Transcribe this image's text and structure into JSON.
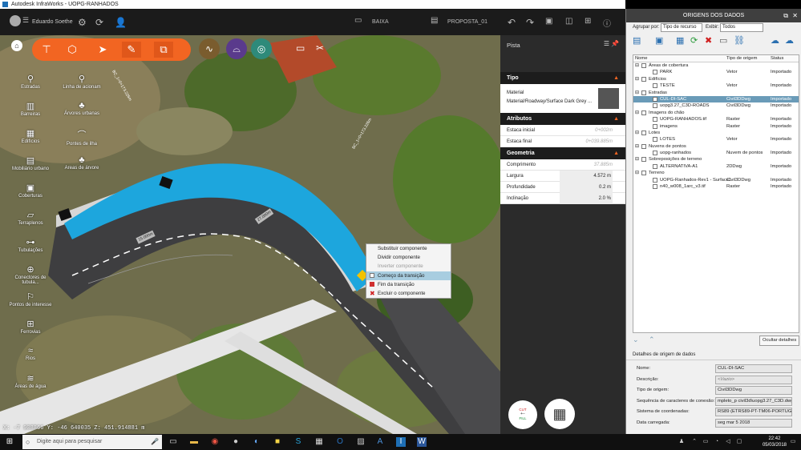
{
  "window": {
    "title": "Autodesk InfraWorks - UOPG-RANHADOS"
  },
  "toolbar": {
    "user": "Eduardo Soethe",
    "scenario": "BAIXA",
    "proposal": "PROPOSTA_01"
  },
  "left_tools": [
    {
      "label": "Estradas",
      "icon": "road-icon"
    },
    {
      "label": "Linha de acionam",
      "icon": "rail-icon"
    },
    {
      "label": "Barreiras",
      "icon": "barrier-icon"
    },
    {
      "label": "Árvores urbanas",
      "icon": "tree-icon"
    },
    {
      "label": "Edifícios",
      "icon": "building-icon"
    },
    {
      "label": "Pontes de ilha",
      "icon": "bridge-icon"
    },
    {
      "label": "Mobiliário urbano",
      "icon": "furniture-icon"
    },
    {
      "label": "Areas de árvore",
      "icon": "tree-area-icon"
    },
    {
      "label": "Coberturas",
      "icon": "coverage-icon"
    },
    {
      "label": "Terraplenos",
      "icon": "terrain-icon"
    },
    {
      "label": "Tubulações",
      "icon": "pipe-icon"
    },
    {
      "label": "Conectores de tubula...",
      "icon": "pipe-connector-icon"
    },
    {
      "label": "Pontos de interesse",
      "icon": "poi-icon"
    },
    {
      "label": "Ferrovias",
      "icon": "railway-icon"
    },
    {
      "label": "Rios",
      "icon": "river-icon"
    },
    {
      "label": "Áreas de água",
      "icon": "water-icon"
    }
  ],
  "map_labels": {
    "road_left": "15.000m",
    "road_mid": "27.000m",
    "road_right": "BC_1=0+173.226m",
    "road_top": "BC_1=0+173.226m"
  },
  "coordinates": "X: -7 908866 Y: -46 640035 Z: 451.914881 m",
  "context_menu": {
    "items": [
      {
        "label": "Substituir componente",
        "state": "normal"
      },
      {
        "label": "Dividir componente",
        "state": "normal"
      },
      {
        "label": "Inverter componente",
        "state": "disabled"
      },
      {
        "label": "Começo da transição",
        "state": "checkbox"
      },
      {
        "label": "Fim da transição",
        "state": "checked"
      },
      {
        "label": "Excluir o componente",
        "state": "delete"
      }
    ]
  },
  "properties": {
    "title": "Pista",
    "sections": {
      "tipo": "Tipo",
      "atributos": "Atributos",
      "geometria": "Geometria"
    },
    "material_label": "Material",
    "material_value": "Material/Roadway/Surface Dark Grey ...",
    "estaca_inicial": {
      "label": "Estaca inicial",
      "value": "0+002m"
    },
    "estaca_final": {
      "label": "Estaca final",
      "value": "0+039.885m"
    },
    "comprimento": {
      "label": "Comprimento",
      "value": "37.885m"
    },
    "largura": {
      "label": "Largura",
      "value": "4.572 m"
    },
    "profundidade": {
      "label": "Profundidade",
      "value": "0.2 m"
    },
    "inclinacao": {
      "label": "Inclinação",
      "value": "2.0 %"
    },
    "cutfill": {
      "cut": "CUT",
      "fill": "FILL"
    }
  },
  "data_sources": {
    "title": "ORIGENS DOS DADOS",
    "group_by_label": "Agrupar por:",
    "group_by_value": "Tipo de recurso",
    "show_label": "Exibir:",
    "show_value": "Todos",
    "columns": [
      "Nome",
      "Tipo de origem",
      "Status"
    ],
    "rows": [
      {
        "level": 0,
        "name": "Áreas de cobertura",
        "type": "",
        "status": ""
      },
      {
        "level": 1,
        "name": "PARK",
        "type": "Vetor",
        "status": "Importado"
      },
      {
        "level": 0,
        "name": "Edifícios",
        "type": "",
        "status": ""
      },
      {
        "level": 1,
        "name": "TESTE",
        "type": "Vetor",
        "status": "Importado"
      },
      {
        "level": 0,
        "name": "Estradas",
        "type": "",
        "status": ""
      },
      {
        "level": 1,
        "name": "CUL-DI-SAC",
        "type": "Civil3DDwg",
        "status": "Importado",
        "selected": true
      },
      {
        "level": 1,
        "name": "uopg3.27_C3D-ROADS",
        "type": "Civil3DDwg",
        "status": "Importado"
      },
      {
        "level": 0,
        "name": "Imagens do chão",
        "type": "",
        "status": ""
      },
      {
        "level": 1,
        "name": "UOPG-RANHADOS.tif",
        "type": "Raster",
        "status": "Importado"
      },
      {
        "level": 1,
        "name": "imagens",
        "type": "Raster",
        "status": "Importado"
      },
      {
        "level": 0,
        "name": "Lotes",
        "type": "",
        "status": ""
      },
      {
        "level": 1,
        "name": "LOTES",
        "type": "Vetor",
        "status": "Importado"
      },
      {
        "level": 0,
        "name": "Nuvens de pontos",
        "type": "",
        "status": ""
      },
      {
        "level": 1,
        "name": "uopg-ranhados",
        "type": "Nuvem de pontos",
        "status": "Importado"
      },
      {
        "level": 0,
        "name": "Sobreposições de terreno",
        "type": "",
        "status": ""
      },
      {
        "level": 1,
        "name": "ALTERNATIVA-A1",
        "type": "2DDwg",
        "status": "Importado"
      },
      {
        "level": 0,
        "name": "Terreno",
        "type": "",
        "status": ""
      },
      {
        "level": 1,
        "name": "UOPG-Ranhados-Rev1 - Surface1",
        "type": "Civil3DDwg",
        "status": "Importado"
      },
      {
        "level": 1,
        "name": "n40_w008_1arc_v3.tif",
        "type": "Raster",
        "status": "Importado"
      }
    ],
    "hide_details": "Ocultar detalhes",
    "details_title": "Detalhes de origem de dados",
    "details": [
      {
        "label": "Nome:",
        "value": "CUL-DI-SAC",
        "empty": false
      },
      {
        "label": "Descrição:",
        "value": "<Vazio>",
        "empty": true
      },
      {
        "label": "Tipo de origem:",
        "value": "Civil3DDwg",
        "empty": false
      },
      {
        "label": "Sequência de caracteres de conexão:",
        "value": "mpleto_p civil3d\\uopg3.27_C3D.dwg",
        "empty": false
      },
      {
        "label": "Sistema de coordenadas:",
        "value": "RS89 (ETRS89-PT-TM06-PORTUGAL)",
        "empty": false
      },
      {
        "label": "Data carregada:",
        "value": "seg mar 5 2018",
        "empty": false
      }
    ]
  },
  "taskbar": {
    "search_placeholder": "Digite aqui para pesquisar",
    "time": "22:42",
    "date": "05/03/2018"
  }
}
